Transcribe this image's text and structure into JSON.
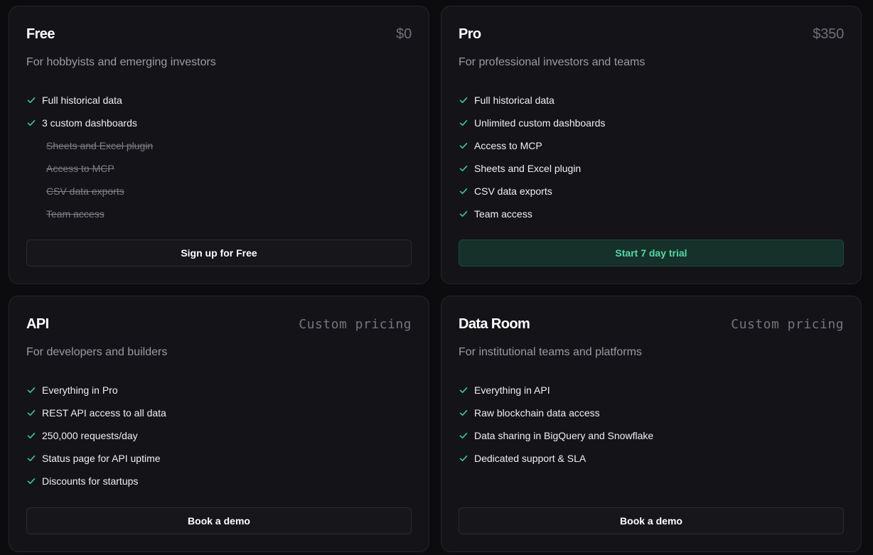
{
  "colors": {
    "background": "#0c0c0f",
    "card": "#141418",
    "border": "#24242a",
    "check": "#3fc79a",
    "accent_button_bg": "#16302a",
    "accent_button_text": "#56d9a6"
  },
  "plans": [
    {
      "name": "Free",
      "price": "$0",
      "subtitle": "For hobbyists and emerging investors",
      "features": [
        {
          "label": "Full historical data",
          "included": true
        },
        {
          "label": "3 custom dashboards",
          "included": true
        },
        {
          "label": "Sheets and Excel plugin",
          "included": false
        },
        {
          "label": "Access to MCP",
          "included": false
        },
        {
          "label": "CSV data exports",
          "included": false
        },
        {
          "label": "Team access",
          "included": false
        }
      ],
      "cta": "Sign up for Free",
      "check_icon": "check-icon"
    },
    {
      "name": "Pro",
      "price": "$350",
      "subtitle": "For professional investors and teams",
      "features": [
        {
          "label": "Full historical data",
          "included": true
        },
        {
          "label": "Unlimited custom dashboards",
          "included": true
        },
        {
          "label": "Access to MCP",
          "included": true
        },
        {
          "label": "Sheets and Excel plugin",
          "included": true
        },
        {
          "label": "CSV data exports",
          "included": true
        },
        {
          "label": "Team access",
          "included": true
        }
      ],
      "cta": "Start 7 day trial",
      "check_icon": "check-icon"
    },
    {
      "name": "API",
      "price": "Custom pricing",
      "subtitle": "For developers and builders",
      "features": [
        {
          "label": "Everything in Pro",
          "included": true
        },
        {
          "label": "REST API access to all data",
          "included": true
        },
        {
          "label": "250,000 requests/day",
          "included": true
        },
        {
          "label": "Status page for API uptime",
          "included": true
        },
        {
          "label": "Discounts for startups",
          "included": true
        }
      ],
      "cta": "Book a demo",
      "check_icon": "check-icon"
    },
    {
      "name": "Data Room",
      "price": "Custom pricing",
      "subtitle": "For institutional teams and platforms",
      "features": [
        {
          "label": "Everything in API",
          "included": true
        },
        {
          "label": "Raw blockchain data access",
          "included": true
        },
        {
          "label": "Data sharing in BigQuery and Snowflake",
          "included": true
        },
        {
          "label": "Dedicated support & SLA",
          "included": true
        }
      ],
      "cta": "Book a demo",
      "check_icon": "check-icon"
    }
  ]
}
